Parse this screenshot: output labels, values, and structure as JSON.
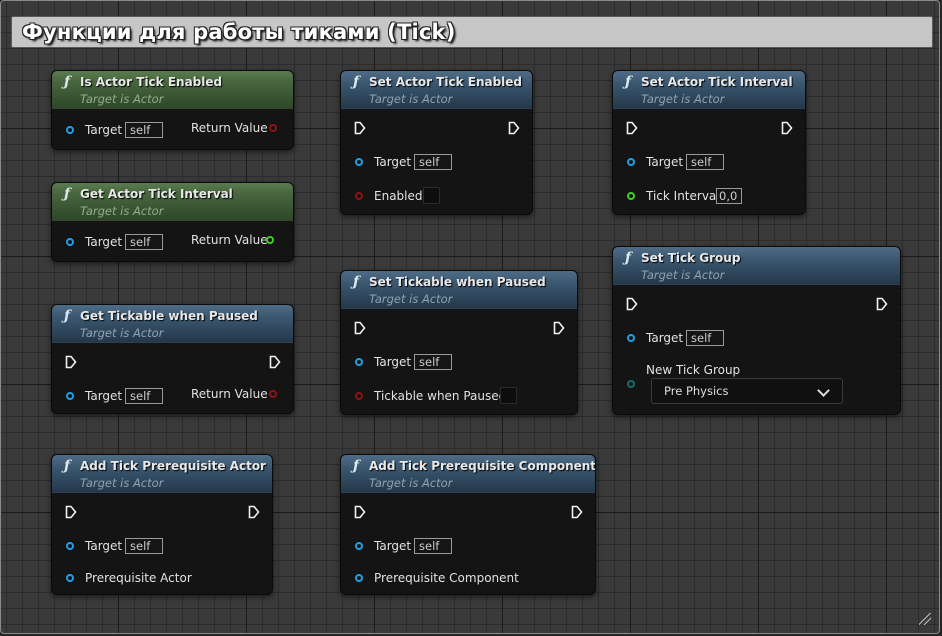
{
  "comment": {
    "title": "Функции для работы тиками (Tick)"
  },
  "icons": {
    "function": "function-icon",
    "exec": "exec-pin-icon"
  },
  "colors": {
    "pure_header": "#47663f",
    "impure_header": "#3a566f",
    "object_pin": "#1f9fe6",
    "bool_pin": "#8c1414",
    "float_pin": "#3fcf26",
    "byte_pin": "#0f6f6a"
  },
  "nodes": [
    {
      "id": "is_actor_tick_enabled",
      "title": "Is Actor Tick Enabled",
      "subtitle": "Target is Actor",
      "target_label": "Target",
      "target_value": "self",
      "return_label": "Return Value"
    },
    {
      "id": "get_actor_tick_interval",
      "title": "Get Actor Tick Interval",
      "subtitle": "Target is Actor",
      "target_label": "Target",
      "target_value": "self",
      "return_label": "Return Value"
    },
    {
      "id": "get_tickable_when_paused",
      "title": "Get Tickable when Paused",
      "subtitle": "Target is Actor",
      "target_label": "Target",
      "target_value": "self",
      "return_label": "Return Value"
    },
    {
      "id": "add_tick_prerequisite_actor",
      "title": "Add Tick Prerequisite Actor",
      "subtitle": "Target is Actor",
      "target_label": "Target",
      "target_value": "self",
      "param_label": "Prerequisite Actor"
    },
    {
      "id": "set_actor_tick_enabled",
      "title": "Set Actor Tick Enabled",
      "subtitle": "Target is Actor",
      "target_label": "Target",
      "target_value": "self",
      "param_label": "Enabled"
    },
    {
      "id": "set_tickable_when_paused",
      "title": "Set Tickable when Paused",
      "subtitle": "Target is Actor",
      "target_label": "Target",
      "target_value": "self",
      "param_label": "Tickable when Paused"
    },
    {
      "id": "add_tick_prerequisite_component",
      "title": "Add Tick Prerequisite Component",
      "subtitle": "Target is Actor",
      "target_label": "Target",
      "target_value": "self",
      "param_label": "Prerequisite Component"
    },
    {
      "id": "set_actor_tick_interval",
      "title": "Set Actor Tick Interval",
      "subtitle": "Target is Actor",
      "target_label": "Target",
      "target_value": "self",
      "param_label": "Tick Interval",
      "param_value": "0,0"
    },
    {
      "id": "set_tick_group",
      "title": "Set Tick Group",
      "subtitle": "Target is Actor",
      "target_label": "Target",
      "target_value": "self",
      "param_label": "New Tick Group",
      "param_value": "Pre Physics"
    }
  ]
}
